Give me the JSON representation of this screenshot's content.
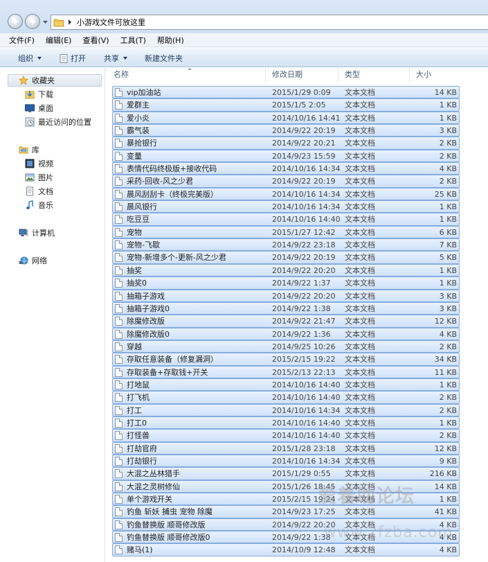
{
  "address_bar": {
    "path": "小游戏文件可放这里"
  },
  "menu": [
    "文件(F)",
    "编辑(E)",
    "查看(V)",
    "工具(T)",
    "帮助(H)"
  ],
  "toolbar": {
    "organize": "组织",
    "open": "打开",
    "share": "共享",
    "new_folder": "新建文件夹"
  },
  "sidebar": {
    "favorites": {
      "label": "收藏夹",
      "items": [
        "下载",
        "桌面",
        "最近访问的位置"
      ]
    },
    "libraries": {
      "label": "库",
      "items": [
        "视频",
        "图片",
        "文档",
        "音乐"
      ]
    },
    "computer": "计算机",
    "network": "网络"
  },
  "columns": {
    "name": "名称",
    "date": "修改日期",
    "type": "类型",
    "size": "大小"
  },
  "files": [
    {
      "name": "vip加油站",
      "date": "2015/1/29 0:09",
      "type": "文本文档",
      "size": "14 KB"
    },
    {
      "name": "爱群主",
      "date": "2015/1/5 2:05",
      "type": "文本文档",
      "size": "1 KB"
    },
    {
      "name": "爱小炎",
      "date": "2014/10/16 14:41",
      "type": "文本文档",
      "size": "1 KB"
    },
    {
      "name": "霸气装",
      "date": "2014/9/22 20:19",
      "type": "文本文档",
      "size": "3 KB"
    },
    {
      "name": "暴抢银行",
      "date": "2014/9/22 20:21",
      "type": "文本文档",
      "size": "2 KB"
    },
    {
      "name": "变量",
      "date": "2014/9/23 15:59",
      "type": "文本文档",
      "size": "2 KB"
    },
    {
      "name": "表情代码终极版+接收代码",
      "date": "2014/10/16 14:34",
      "type": "文本文档",
      "size": "4 KB"
    },
    {
      "name": "采药-回收-风之少君",
      "date": "2014/9/22 20:19",
      "type": "文本文档",
      "size": "2 KB"
    },
    {
      "name": "晨风刮刮卡（终极完美版）",
      "date": "2014/10/16 14:34",
      "type": "文本文档",
      "size": "25 KB"
    },
    {
      "name": "晨风银行",
      "date": "2014/10/16 14:34",
      "type": "文本文档",
      "size": "1 KB"
    },
    {
      "name": "吃豆豆",
      "date": "2014/10/16 14:40",
      "type": "文本文档",
      "size": "1 KB"
    },
    {
      "name": "宠物",
      "date": "2015/1/27 12:42",
      "type": "文本文档",
      "size": "6 KB"
    },
    {
      "name": "宠物-飞歇",
      "date": "2014/9/22 23:18",
      "type": "文本文档",
      "size": "7 KB"
    },
    {
      "name": "宠物-新增多个-更新-风之少君",
      "date": "2014/9/22 20:19",
      "type": "文本文档",
      "size": "5 KB"
    },
    {
      "name": "抽奖",
      "date": "2014/9/22 20:20",
      "type": "文本文档",
      "size": "1 KB"
    },
    {
      "name": "抽奖0",
      "date": "2014/9/22 1:37",
      "type": "文本文档",
      "size": "1 KB"
    },
    {
      "name": "抽箱子游戏",
      "date": "2014/9/22 20:20",
      "type": "文本文档",
      "size": "3 KB"
    },
    {
      "name": "抽箱子游戏0",
      "date": "2014/9/22 1:38",
      "type": "文本文档",
      "size": "3 KB"
    },
    {
      "name": "除魔修改版",
      "date": "2014/9/22 21:47",
      "type": "文本文档",
      "size": "12 KB"
    },
    {
      "name": "除魔修改版0",
      "date": "2014/9/22 1:36",
      "type": "文本文档",
      "size": "4 KB"
    },
    {
      "name": "穿越",
      "date": "2014/9/25 10:26",
      "type": "文本文档",
      "size": "2 KB"
    },
    {
      "name": "存取任意装备（修复漏洞）",
      "date": "2015/2/15 19:22",
      "type": "文本文档",
      "size": "34 KB"
    },
    {
      "name": "存取装备+存取钱+开关",
      "date": "2015/2/13 22:13",
      "type": "文本文档",
      "size": "11 KB"
    },
    {
      "name": "打地鼠",
      "date": "2014/10/16 14:40",
      "type": "文本文档",
      "size": "1 KB"
    },
    {
      "name": "打飞机",
      "date": "2014/10/16 14:40",
      "type": "文本文档",
      "size": "2 KB"
    },
    {
      "name": "打工",
      "date": "2014/10/16 14:34",
      "type": "文本文档",
      "size": "2 KB"
    },
    {
      "name": "打工0",
      "date": "2014/10/16 14:40",
      "type": "文本文档",
      "size": "1 KB"
    },
    {
      "name": "打怪兽",
      "date": "2014/10/16 14:40",
      "type": "文本文档",
      "size": "2 KB"
    },
    {
      "name": "打劫官府",
      "date": "2015/1/28 23:18",
      "type": "文本文档",
      "size": "12 KB"
    },
    {
      "name": "打劫银行",
      "date": "2014/10/16 14:34",
      "type": "文本文档",
      "size": "9 KB"
    },
    {
      "name": "大混之丛林猎手",
      "date": "2015/1/29 0:55",
      "type": "文本文档",
      "size": "216 KB"
    },
    {
      "name": "大混之灵树修仙",
      "date": "2015/1/26 18:45",
      "type": "文本文档",
      "size": "14 KB"
    },
    {
      "name": "单个游戏开关",
      "date": "2015/2/15 19:24",
      "type": "文本文档",
      "size": "1 KB"
    },
    {
      "name": "钓鱼 斩妖 捕虫 宠物 除魔",
      "date": "2014/9/23 17:25",
      "type": "文本文档",
      "size": "41 KB"
    },
    {
      "name": "钓鱼替换版 顺哥修改版",
      "date": "2014/9/22 20:20",
      "type": "文本文档",
      "size": "4 KB"
    },
    {
      "name": "钓鱼替换版 顺哥修改版0",
      "date": "2014/9/22 1:38",
      "type": "文本文档",
      "size": "4 KB"
    },
    {
      "name": "赌马(1)",
      "date": "2014/10/9 12:48",
      "type": "文本文档",
      "size": "4 KB"
    }
  ],
  "watermark": {
    "text": "爱着助论坛",
    "url": "www.2fzba.com"
  }
}
